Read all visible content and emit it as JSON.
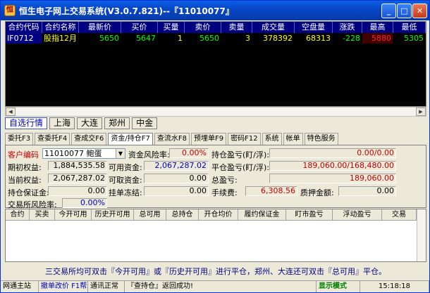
{
  "window": {
    "title": "恒生电子网上交易系统(V3.0.7.821)--『11010077』"
  },
  "quote": {
    "columns": [
      "合约代码",
      "合约名称",
      "最新价",
      "买价",
      "买量",
      "卖价",
      "卖量",
      "成交量",
      "空盘量",
      "涨跌",
      "最高",
      "最低"
    ],
    "row": [
      "IF0712",
      "股指12月",
      "5650",
      "5647",
      "1",
      "5650",
      "3",
      "378392",
      "68313",
      "-228",
      "5880",
      "5305"
    ]
  },
  "market_tabs": [
    "自选行情",
    "上海",
    "大连",
    "郑州",
    "中金"
  ],
  "function_tabs": [
    "委托F3",
    "查委托F4",
    "查成交F6",
    "资金/持仓F7",
    "查流水F8",
    "预埋单F9",
    "密码F12",
    "系统",
    "帐单",
    "特色服务"
  ],
  "fund": {
    "account_label": "客户编码",
    "account_value": "11010077 鲍蛋",
    "risk_label": "资金风险率:",
    "risk_value": "0.00%",
    "pos_pl_label": "持仓盈亏(盯/浮):",
    "pos_pl_value": "0.00/0.00",
    "init_equity_label": "期初权益:",
    "init_equity_value": "1,884,535.58",
    "avail_label": "可用资金:",
    "avail_value": "2,067,287.02",
    "close_pl_label": "平仓盈亏(盯/浮):",
    "close_pl_value": "189,060.00/168,480.00",
    "cur_equity_label": "当前权益:",
    "cur_equity_value": "2,067,287.02",
    "withdraw_label": "可取资金:",
    "withdraw_value": "0.00",
    "total_pl_label": "总盈亏:",
    "total_pl_value": "189,060.00",
    "margin_label": "持仓保证金:",
    "margin_value": "0.00",
    "frozen_label": "挂单冻结:",
    "frozen_value": "0.00",
    "fee_label": "手续费:",
    "fee_value": "6,308.56",
    "pledge_label": "质押金额:",
    "pledge_value": "0.00",
    "exch_risk_label": "交易所风险率:",
    "exch_risk_value": "0.00%"
  },
  "positions": {
    "columns": [
      "合约",
      "买卖",
      "今开可用",
      "历史开可用",
      "总可用",
      "总持仓",
      "开仓均价",
      "履约保证金",
      "盯市盈亏",
      "浮动盈亏",
      "交易"
    ]
  },
  "notice": "三交易所均可双击『今开可用』或『历史开可用』进行平仓，郑州、大连还可双击『总可用』平仓。",
  "status": [
    "网通主站",
    "撤单改价 F1帮助",
    "通讯正常",
    "『查持仓』返回成功!",
    "显示模式",
    "15:18:18"
  ]
}
